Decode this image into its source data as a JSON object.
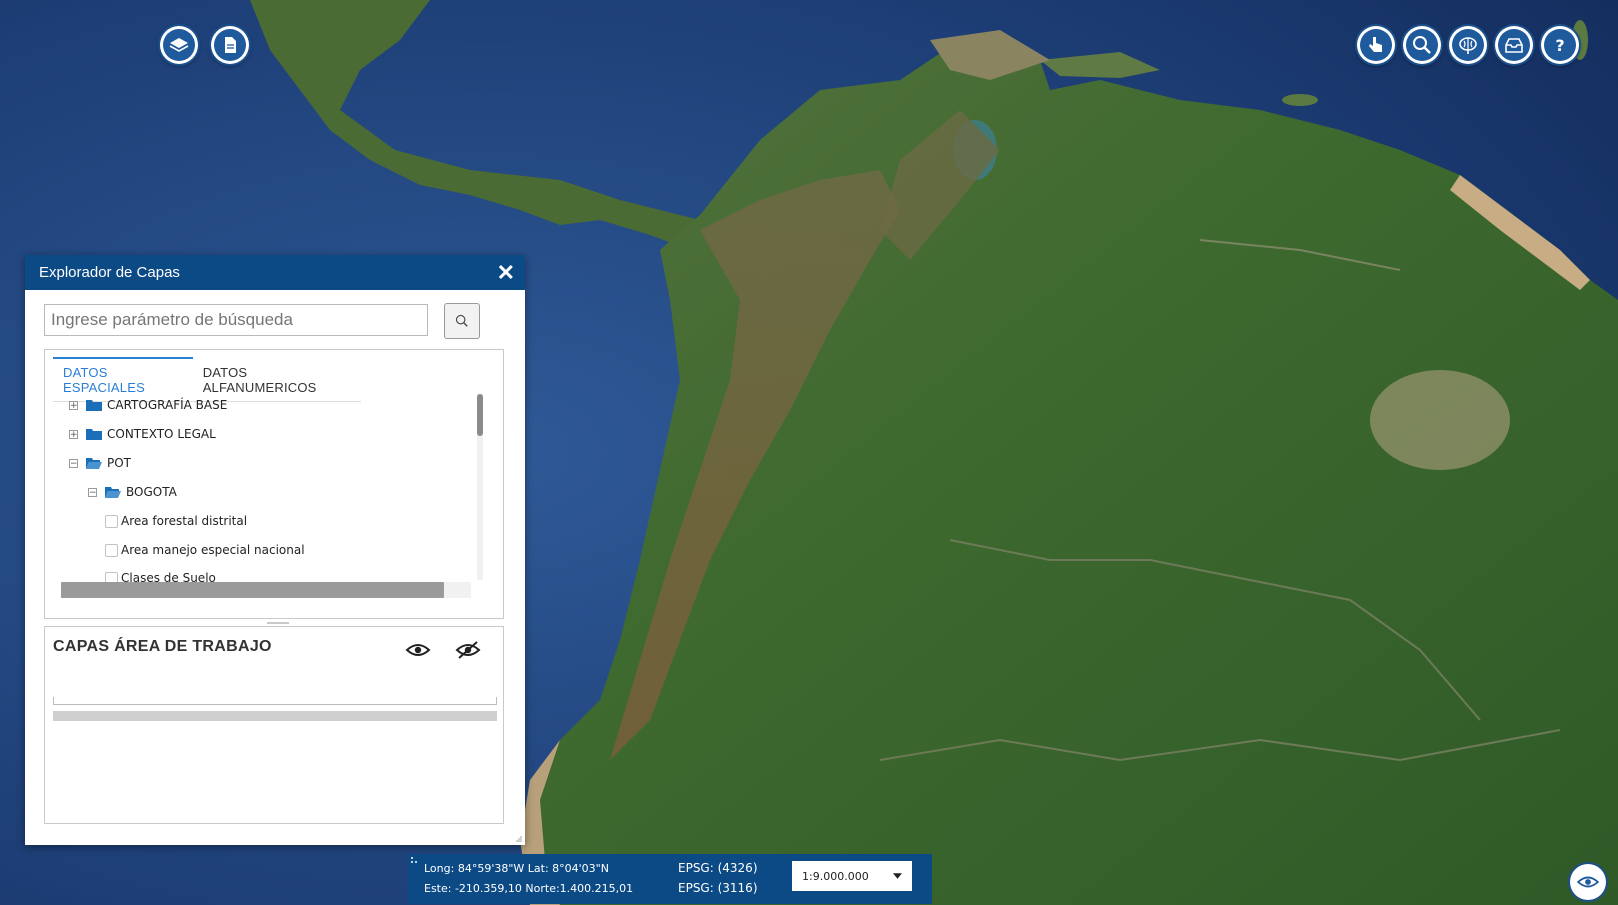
{
  "toolbar_left": [
    {
      "name": "layers-icon"
    },
    {
      "name": "document-icon"
    }
  ],
  "toolbar_right": [
    {
      "name": "pointer-hand-icon"
    },
    {
      "name": "magnifier-icon"
    },
    {
      "name": "brain-icon"
    },
    {
      "name": "inbox-print-icon"
    },
    {
      "name": "help-icon"
    }
  ],
  "panel": {
    "title": "Explorador de Capas",
    "search_placeholder": "Ingrese parámetro de búsqueda",
    "tabs": [
      "DATOS ESPACIALES",
      "DATOS ALFANUMERICOS"
    ],
    "tree": [
      {
        "label": "CARTOGRAFÍA BASE",
        "expander": "+"
      },
      {
        "label": "CONTEXTO LEGAL",
        "expander": "+"
      },
      {
        "label": "POT",
        "expander": "−"
      },
      {
        "label": "BOGOTA",
        "expander": "−"
      },
      {
        "label": "Area forestal distrital"
      },
      {
        "label": "Area manejo especial nacional"
      },
      {
        "label": "Clases de Suelo"
      }
    ],
    "work_title": "CAPAS ÁREA DE TRABAJO"
  },
  "status": {
    "coord_geo": "Long: 84°59'38\"W Lat: 8°04'03\"N",
    "coord_proj": "Este: -210.359,10 Norte:1.400.215,01",
    "epsg_geo": "EPSG: (4326)",
    "epsg_proj": "EPSG: (3116)",
    "scale": "1:9.000.000"
  },
  "colors": {
    "ocean": "#1f3f77",
    "land": "#3d6a2e",
    "header": "#0c4a86",
    "accent": "#2a7fd4"
  }
}
